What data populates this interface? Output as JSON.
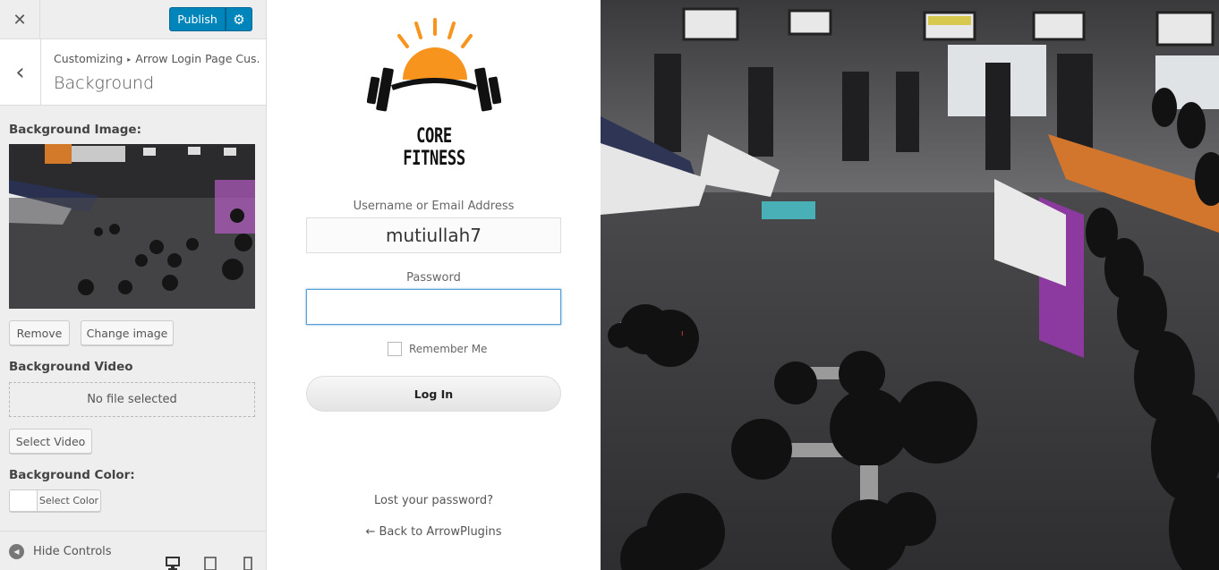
{
  "sidebar": {
    "close_glyph": "✕",
    "publish_label": "Publish",
    "settings_glyph": "⚙",
    "back_glyph": "‹",
    "breadcrumb": {
      "parent": "Customizing",
      "sep": "▸",
      "current": "Arrow Login Page Cus..."
    },
    "section_title": "Background",
    "background_image_label": "Background Image:",
    "remove_label": "Remove",
    "change_image_label": "Change image",
    "background_video_label": "Background Video",
    "no_file_text": "No file selected",
    "select_video_label": "Select Video",
    "background_color_label": "Background Color:",
    "select_color_label": "Select Color",
    "hide_controls_label": "Hide Controls",
    "hide_controls_glyph": "◀",
    "icons": {
      "close": "close-icon",
      "settings": "gear-icon",
      "back": "chevron-left-icon",
      "desktop": "desktop-icon",
      "tablet": "tablet-icon",
      "mobile": "mobile-icon"
    }
  },
  "login": {
    "logo_text": "CORE FITNESS",
    "username_label": "Username or Email Address",
    "username_value": "mutiullah7",
    "password_label": "Password",
    "password_value": "",
    "remember_label": "Remember Me",
    "remember_checked": false,
    "login_button": "Log In",
    "lost_password": "Lost your password?",
    "back_link": "← Back to ArrowPlugins"
  },
  "colors": {
    "publish_blue": "#0085ba",
    "logo_orange": "#f7941d",
    "sidebar_bg": "#eeeeee"
  }
}
